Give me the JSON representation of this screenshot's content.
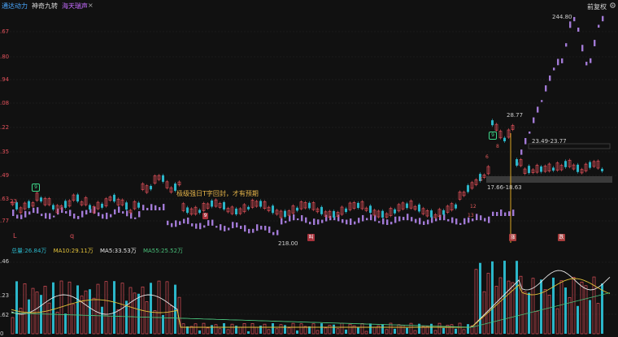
{
  "tabs": [
    {
      "label": "通达动力",
      "style": "active"
    },
    {
      "label": "神奇九转",
      "style": "normal"
    },
    {
      "label": "海天瑞声",
      "style": "purple"
    }
  ],
  "close_glyph": "×",
  "adjust_label": "前复权",
  "y_axis": [
    ".67",
    ".80",
    ".94",
    ".08",
    ".22",
    ".35",
    ".49",
    ".63",
    ".77"
  ],
  "vol_axis": [
    ".46",
    ".23",
    ".62",
    "0"
  ],
  "ma": {
    "vol": "总量:26.84万",
    "ma10": "MA10:29.11万",
    "ma5": "MA5:33.53万",
    "ma55": "MA55:25.52万"
  },
  "annotations": {
    "high": "244.80",
    "peak2": "28.77",
    "range_upper": "23.49-23.77",
    "range_lower": "17.66-18.63",
    "low": "218.00",
    "left_23": "23",
    "callout": "极级强日T字回封，才有预期"
  },
  "markers": {
    "L": "L",
    "q": "q",
    "b_mark": "叫",
    "zhang": "涨",
    "die": "跌",
    "badge9": "9"
  },
  "ticks": [
    "13",
    "12",
    "5",
    "6",
    "8",
    "5",
    "9",
    "8"
  ],
  "colors": {
    "up": "#e0505a",
    "down": "#2bb6c9",
    "purple": "#a27ad6",
    "ma_yellow": "#e2c23a",
    "ma_white": "#e6e6e6",
    "ma_green": "#49c07a",
    "vol_blue": "#2bb6c9"
  }
}
